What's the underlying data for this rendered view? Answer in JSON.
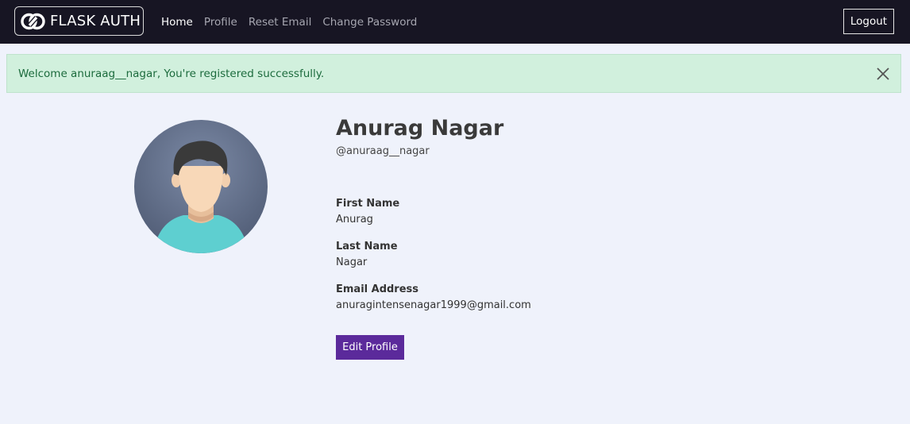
{
  "navbar": {
    "brand": "FLASK AUTH",
    "links": [
      {
        "label": "Home",
        "active": true
      },
      {
        "label": "Profile",
        "active": false
      },
      {
        "label": "Reset Email",
        "active": false
      },
      {
        "label": "Change Password",
        "active": false
      }
    ],
    "logout_label": "Logout"
  },
  "alert": {
    "message": "Welcome anuraag__nagar, You're registered successfully.",
    "close_icon": "close-icon"
  },
  "profile": {
    "full_name": "Anurag Nagar",
    "username": "@anuraag__nagar",
    "fields": {
      "first_name": {
        "label": "First Name",
        "value": "Anurag"
      },
      "last_name": {
        "label": "Last Name",
        "value": "Nagar"
      },
      "email": {
        "label": "Email Address",
        "value": "anuragintensenagar1999@gmail.com"
      }
    },
    "edit_button_label": "Edit Profile"
  },
  "colors": {
    "navbar_bg": "#171523",
    "page_bg": "#eff2fb",
    "alert_bg": "#d1f0dd",
    "alert_text": "#1c6b3d",
    "edit_button_bg": "#5b2a9b"
  }
}
